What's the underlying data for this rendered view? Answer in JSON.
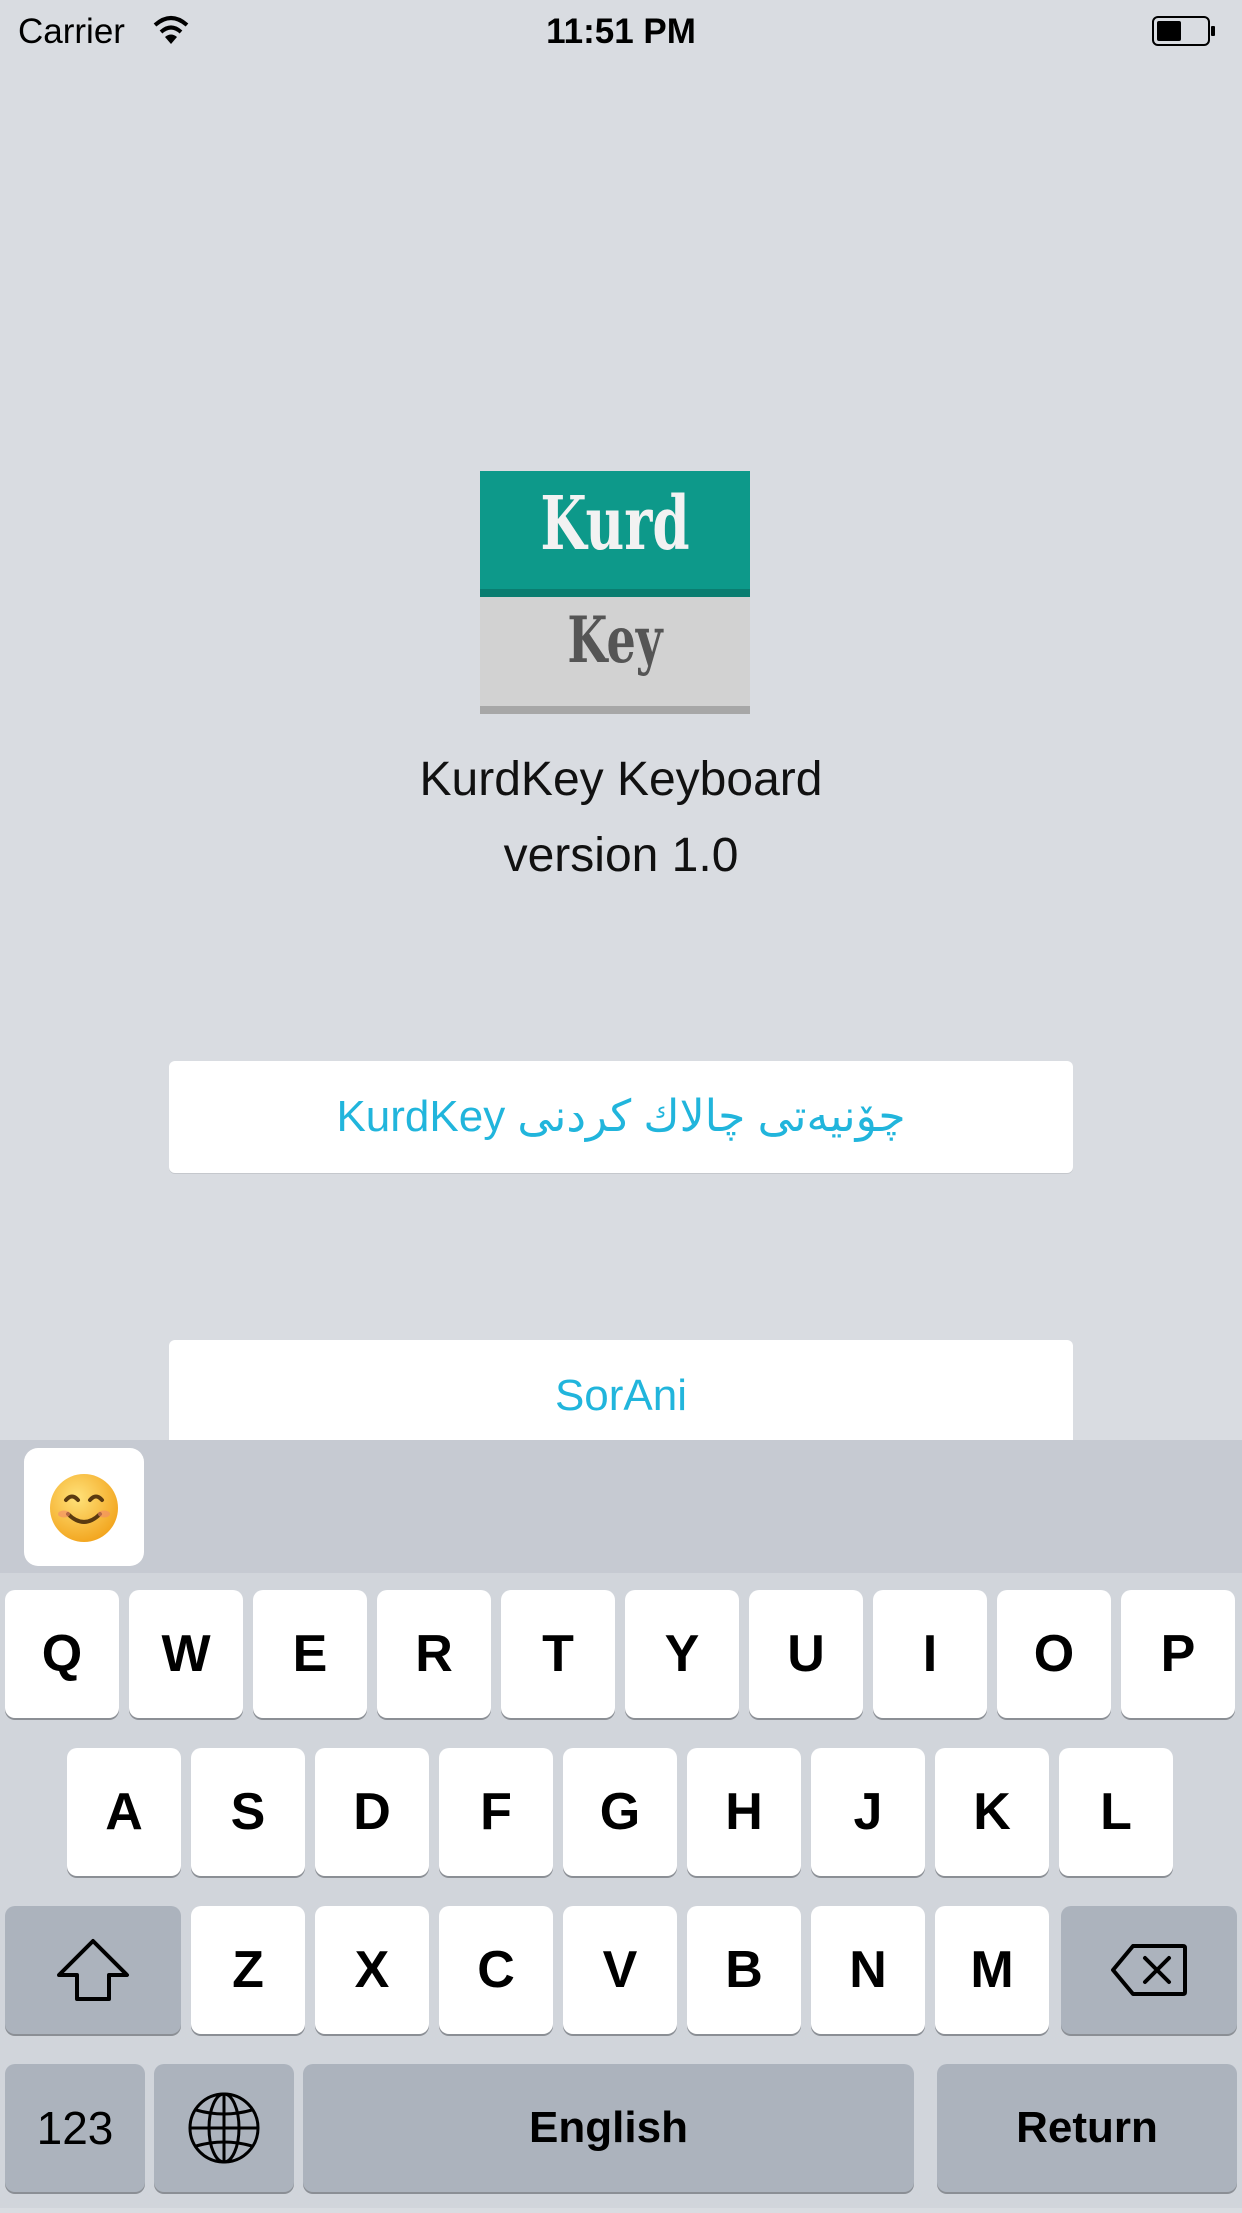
{
  "status_bar": {
    "carrier": "Carrier",
    "time": "11:51 PM"
  },
  "logo": {
    "line1": "Kurd",
    "line2": "Key",
    "colors": {
      "top": "#0d998a",
      "bottom": "#d2d2d2"
    }
  },
  "app": {
    "name": "KurdKey Keyboard",
    "version": "version 1.0"
  },
  "buttons": {
    "activate": "KurdKey  چۆنیەتی چالاك كردنی",
    "sorani": "SorAni"
  },
  "keyboard": {
    "row1": [
      "Q",
      "W",
      "E",
      "R",
      "T",
      "Y",
      "U",
      "I",
      "O",
      "P"
    ],
    "row2": [
      "A",
      "S",
      "D",
      "F",
      "G",
      "H",
      "J",
      "K",
      "L"
    ],
    "row3": [
      "Z",
      "X",
      "C",
      "V",
      "B",
      "N",
      "M"
    ],
    "numbers_key": "123",
    "space_key": "English",
    "return_key": "Return",
    "icons": {
      "shift": "shift-icon",
      "delete": "delete-icon",
      "globe": "globe-icon",
      "emoji": "smiley-emoji"
    }
  },
  "accent_color": "#21b5dc"
}
